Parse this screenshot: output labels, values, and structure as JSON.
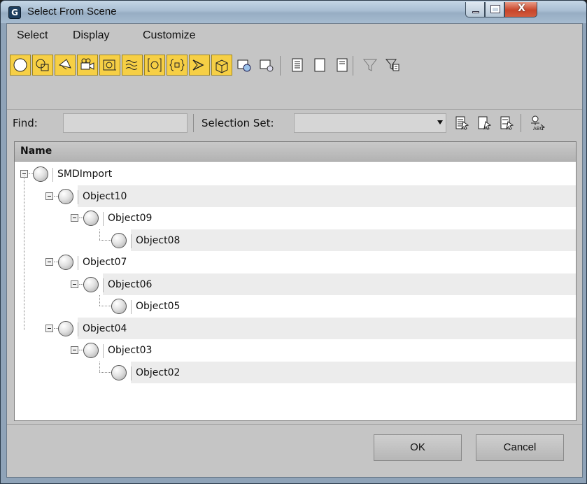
{
  "window": {
    "title": "Select From Scene",
    "app_icon": "3ds-max-icon",
    "icon_letter": "G"
  },
  "window_controls": {
    "minimize": "minimize-icon",
    "maximize": "maximize-icon",
    "close_glyph": "X"
  },
  "menu": [
    {
      "label": "Select"
    },
    {
      "label": "Display"
    },
    {
      "label": "Customize"
    }
  ],
  "toolbar": {
    "toggles": [
      {
        "icon": "geometry-filter-icon",
        "active": true
      },
      {
        "icon": "shapes-filter-icon",
        "active": true
      },
      {
        "icon": "lights-filter-icon",
        "active": true
      },
      {
        "icon": "cameras-filter-icon",
        "active": true
      },
      {
        "icon": "helpers-filter-icon",
        "active": true
      },
      {
        "icon": "space-warps-filter-icon",
        "active": true
      },
      {
        "icon": "groups-filter-icon",
        "active": true
      },
      {
        "icon": "xrefs-filter-icon",
        "active": true
      },
      {
        "icon": "bones-filter-icon",
        "active": true
      },
      {
        "icon": "containers-filter-icon",
        "active": true
      },
      {
        "icon": "frozen-objects-icon",
        "active": false
      },
      {
        "icon": "hidden-objects-icon",
        "active": false
      },
      {
        "icon": "display-all-icon",
        "active": false
      },
      {
        "icon": "display-none-icon",
        "active": false
      },
      {
        "icon": "invert-display-icon",
        "active": false
      },
      {
        "icon": "filter-funnel-icon",
        "active": false
      },
      {
        "icon": "filter-options-icon",
        "active": false
      }
    ]
  },
  "find": {
    "label": "Find:",
    "value": ""
  },
  "selection_set": {
    "label": "Selection Set:",
    "value": ""
  },
  "select_buttons": [
    "select-all-icon",
    "select-none-icon",
    "select-invert-icon",
    "select-by-name-abc-icon"
  ],
  "list": {
    "column_header": "Name",
    "items": [
      {
        "name": "SMDImport",
        "depth": 0,
        "has_children": true
      },
      {
        "name": "Object10",
        "depth": 1,
        "has_children": true
      },
      {
        "name": "Object09",
        "depth": 2,
        "has_children": true
      },
      {
        "name": "Object08",
        "depth": 3,
        "has_children": false
      },
      {
        "name": "Object07",
        "depth": 1,
        "has_children": true
      },
      {
        "name": "Object06",
        "depth": 2,
        "has_children": true
      },
      {
        "name": "Object05",
        "depth": 3,
        "has_children": false
      },
      {
        "name": "Object04",
        "depth": 1,
        "has_children": true
      },
      {
        "name": "Object03",
        "depth": 2,
        "has_children": true
      },
      {
        "name": "Object02",
        "depth": 3,
        "has_children": false
      }
    ]
  },
  "buttons": {
    "ok": "OK",
    "cancel": "Cancel"
  },
  "colors": {
    "active_toggle": "#f6cf45",
    "dialog_bg": "#c5c5c5",
    "title_bar": "#a9bed3"
  }
}
